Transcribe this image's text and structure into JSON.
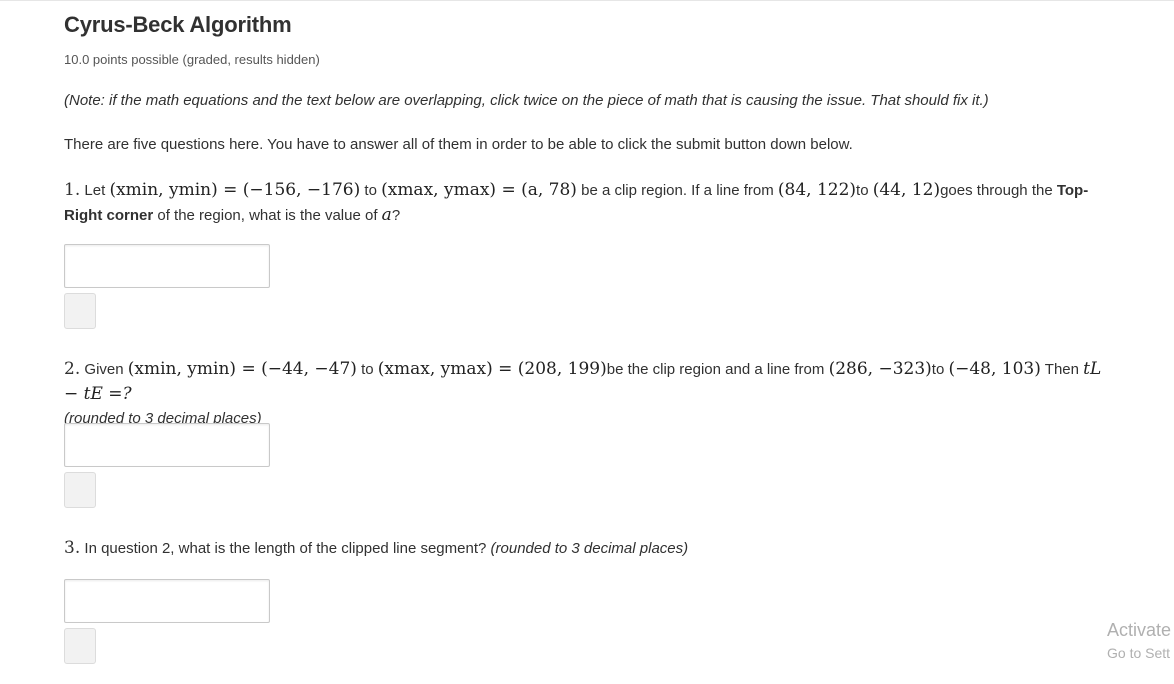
{
  "problem": {
    "title": "Cyrus-Beck Algorithm",
    "points": "10.0 points possible (graded, results hidden)",
    "note": "(Note: if the math equations and the text below are overlapping, click twice on the piece of math that is causing the issue. That should fix it.)",
    "intro": "There are five questions here. You have to answer all of them in order to be able to click the submit button down below."
  },
  "q1": {
    "number": "1.",
    "t_let": "Let",
    "m_min": "(xmin, ymin) = (−156, −176)",
    "t_to": "to",
    "m_max": "(xmax, ymax) = (a, 78)",
    "t_clip": "be a clip region. If a line from",
    "m_p1": "(84, 122)",
    "t_to2": "to",
    "m_p2": "(44, 12)",
    "t_goes": "goes through the",
    "bold": "Top-Right corner",
    "t_rest": "of the region, what is the value of",
    "var": "a",
    "qmark": "?",
    "answer_value": ""
  },
  "q2": {
    "number": "2.",
    "t_given": "Given",
    "m_min": "(xmin, ymin) = (−44, −47)",
    "t_to": "to",
    "m_max": "(xmax, ymax) = (208, 199)",
    "t_clip": "be the clip region and a line from",
    "m_p1": "(286, −323)",
    "t_to2": "to",
    "m_p2": "(−48, 103)",
    "t_then": "Then",
    "m_expr": "tL − tE =?",
    "rounding": "(rounded to 3 decimal places)",
    "answer_value": ""
  },
  "q3": {
    "number": "3.",
    "text": "In question 2, what is the length of the clipped line segment?",
    "rounding": "(rounded to 3 decimal places)",
    "answer_value": ""
  },
  "watermark": {
    "line1": "Activate",
    "line2": "Go to Sett"
  }
}
